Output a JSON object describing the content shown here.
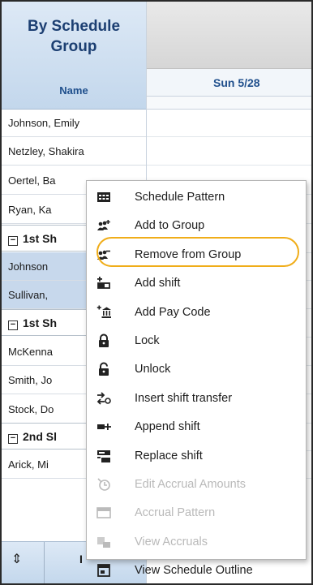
{
  "header": {
    "title_line1": "By Schedule",
    "title_line2": "Group",
    "name_col": "Name",
    "day_col": "Sun 5/28"
  },
  "rows": [
    {
      "type": "row",
      "label": "Johnson, Emily"
    },
    {
      "type": "row",
      "label": "Netzley, Shakira"
    },
    {
      "type": "row",
      "label": "Oertel, Ba"
    },
    {
      "type": "row",
      "label": "Ryan, Ka"
    },
    {
      "type": "group",
      "label": "1st Sh"
    },
    {
      "type": "row",
      "label": "Johnson",
      "selected": true
    },
    {
      "type": "row",
      "label": "Sullivan,",
      "selected": true
    },
    {
      "type": "group",
      "label": "1st Sh"
    },
    {
      "type": "row",
      "label": "McKenna"
    },
    {
      "type": "row",
      "label": "Smith, Jo"
    },
    {
      "type": "row",
      "label": "Stock, Do"
    },
    {
      "type": "group",
      "label": "2nd Sl"
    },
    {
      "type": "row",
      "label": "Arick, Mi"
    }
  ],
  "bottom_bar": {
    "sort_icon": "sort-updown-icon",
    "sort_glyph": "⇕",
    "more_label": "I"
  },
  "context_menu": {
    "items": [
      {
        "label": "Schedule Pattern",
        "icon": "schedule-pattern-icon",
        "enabled": true
      },
      {
        "label": "Add to Group",
        "icon": "add-to-group-icon",
        "enabled": true
      },
      {
        "label": "Remove from Group",
        "icon": "remove-from-group-icon",
        "enabled": true,
        "highlighted": true
      },
      {
        "label": "Add shift",
        "icon": "add-shift-icon",
        "enabled": true
      },
      {
        "label": "Add Pay Code",
        "icon": "add-pay-code-icon",
        "enabled": true
      },
      {
        "label": "Lock",
        "icon": "lock-icon",
        "enabled": true
      },
      {
        "label": "Unlock",
        "icon": "unlock-icon",
        "enabled": true
      },
      {
        "label": "Insert shift transfer",
        "icon": "insert-shift-transfer-icon",
        "enabled": true
      },
      {
        "label": "Append shift",
        "icon": "append-shift-icon",
        "enabled": true
      },
      {
        "label": "Replace shift",
        "icon": "replace-shift-icon",
        "enabled": true
      },
      {
        "label": "Edit Accrual Amounts",
        "icon": "edit-accrual-amounts-icon",
        "enabled": false
      },
      {
        "label": "Accrual Pattern",
        "icon": "accrual-pattern-icon",
        "enabled": false
      },
      {
        "label": "View Accruals",
        "icon": "view-accruals-icon",
        "enabled": false
      },
      {
        "label": "View Schedule Outline",
        "icon": "view-schedule-outline-icon",
        "enabled": true
      }
    ]
  },
  "colors": {
    "header_text": "#1c3f72",
    "selected_row": "#c7d8ec",
    "highlight_ring": "#f0ad19",
    "disabled_text": "#b9b9b9"
  }
}
